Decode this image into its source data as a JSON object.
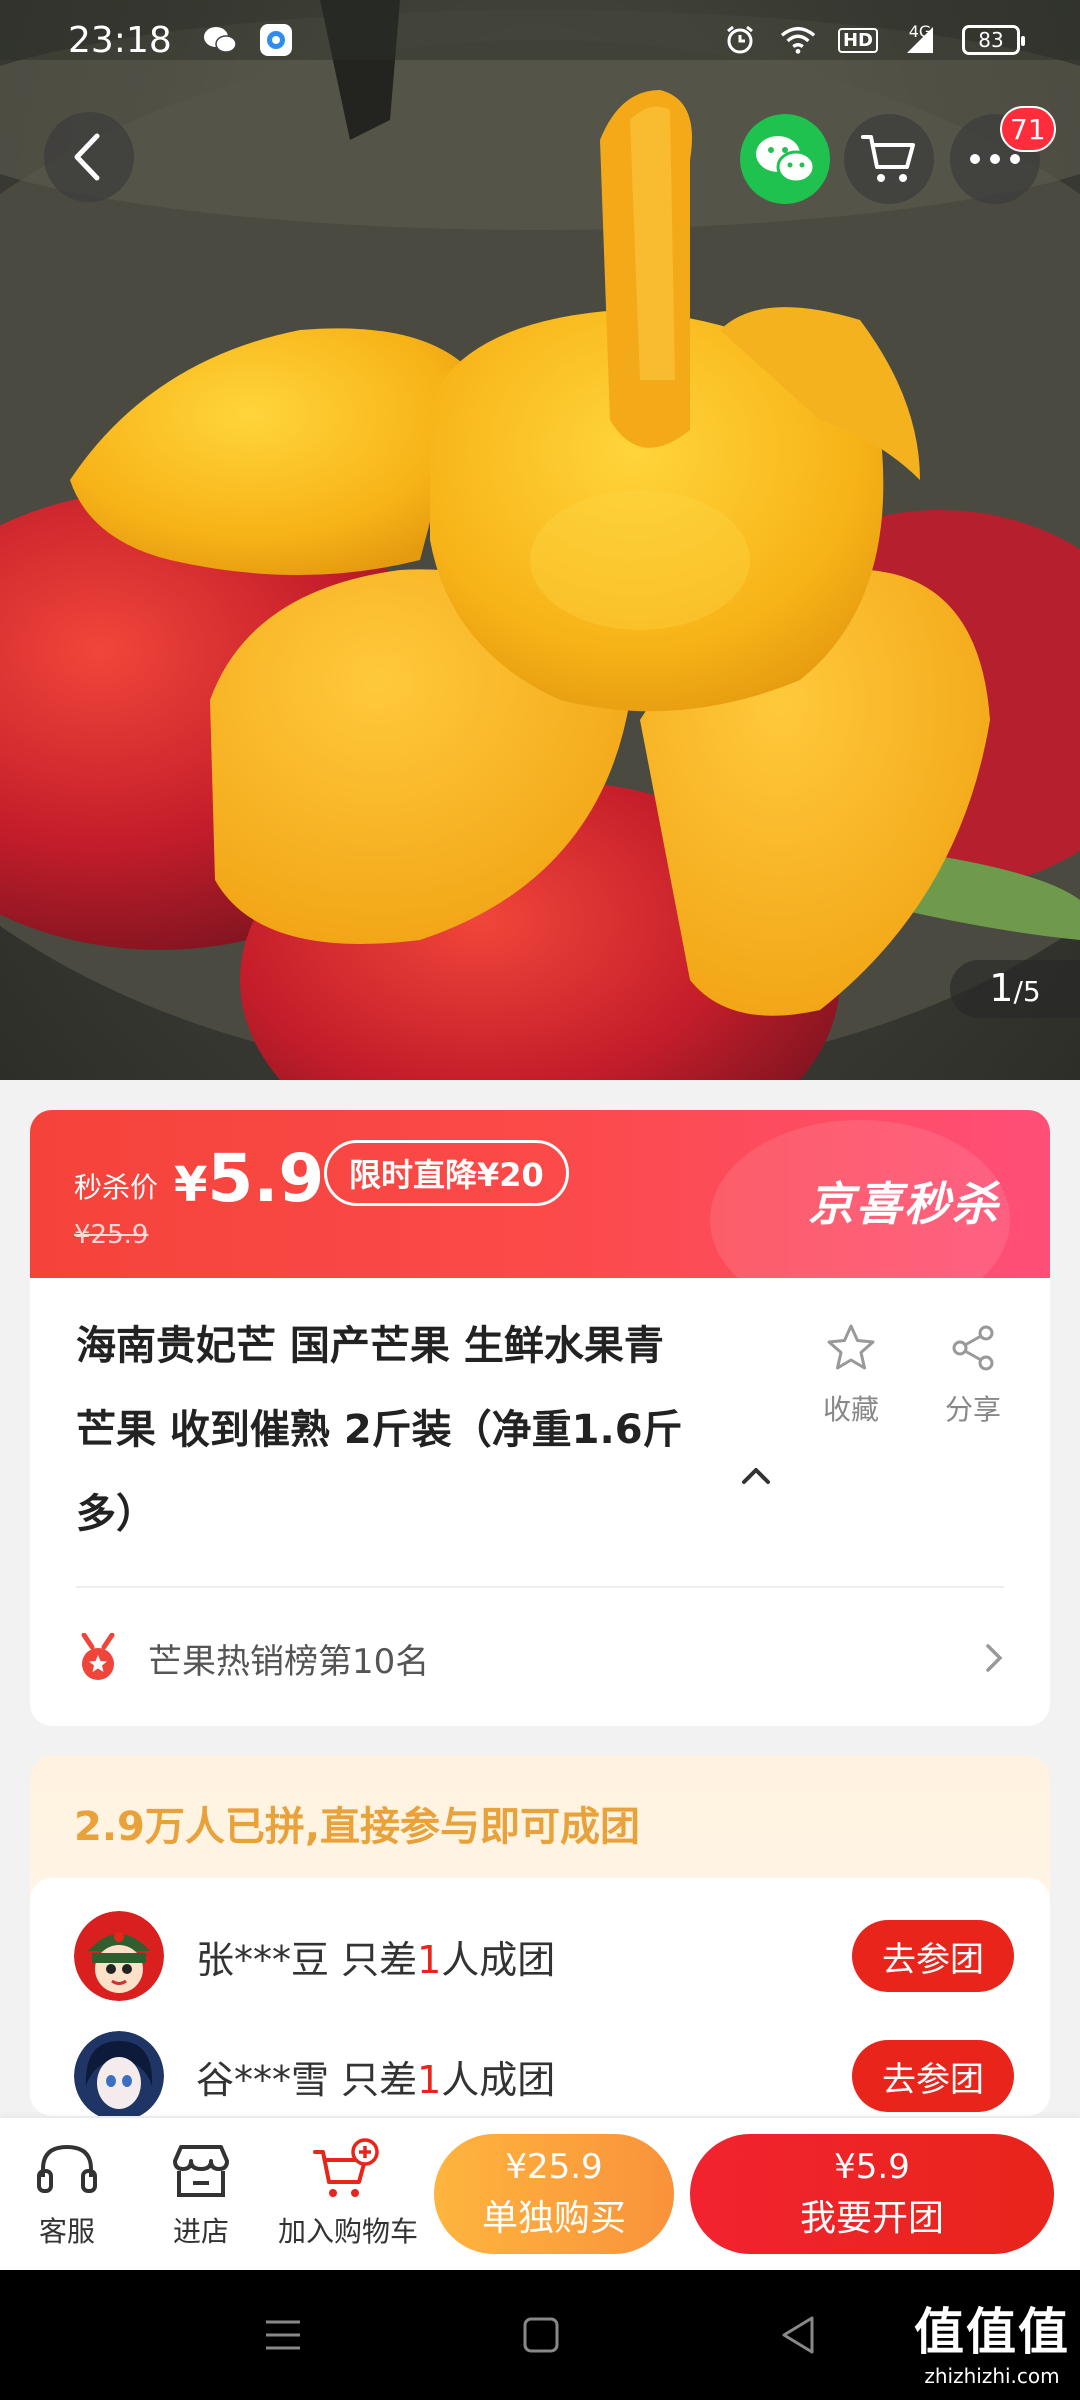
{
  "status_bar": {
    "time": "23:18",
    "hd": "HD",
    "network": "4G",
    "battery": "83"
  },
  "top_nav": {
    "cart_badge": "71"
  },
  "gallery": {
    "current": "1",
    "total": "/5"
  },
  "flash_sale": {
    "label": "秒杀价",
    "price": "5.9",
    "currency": "¥",
    "original_price": "¥25.9",
    "drop_tag": "限时直降¥20",
    "brand": "京喜秒杀"
  },
  "product": {
    "title": "海南贵妃芒 国产芒果 生鲜水果青芒果 收到催熟 2斤装（净重1.6斤多）",
    "favorite_label": "收藏",
    "share_label": "分享",
    "rank_text": "芒果热销榜第10名"
  },
  "group_buy": {
    "header": "2.9万人已拼,直接参与即可成团",
    "rows": [
      {
        "user": "张***豆",
        "text_a": " 只差",
        "count": "1",
        "text_b": "人成团",
        "button": "去参团"
      },
      {
        "user": "谷***雪",
        "text_a": " 只差",
        "count": "1",
        "text_b": "人成团",
        "button": "去参团"
      }
    ]
  },
  "bottom_bar": {
    "service_label": "客服",
    "store_label": "进店",
    "cart_label": "加入购物车",
    "buy_alone_price": "¥25.9",
    "buy_alone_label": "单独购买",
    "buy_group_price": "¥5.9",
    "buy_group_label": "我要开团"
  },
  "watermark": {
    "big": "值值值",
    "small": "zhizhizhi.com"
  },
  "colors": {
    "accent_red": "#e8241b",
    "accent_orange": "#f9923b",
    "gold_text": "#e9a13a"
  }
}
